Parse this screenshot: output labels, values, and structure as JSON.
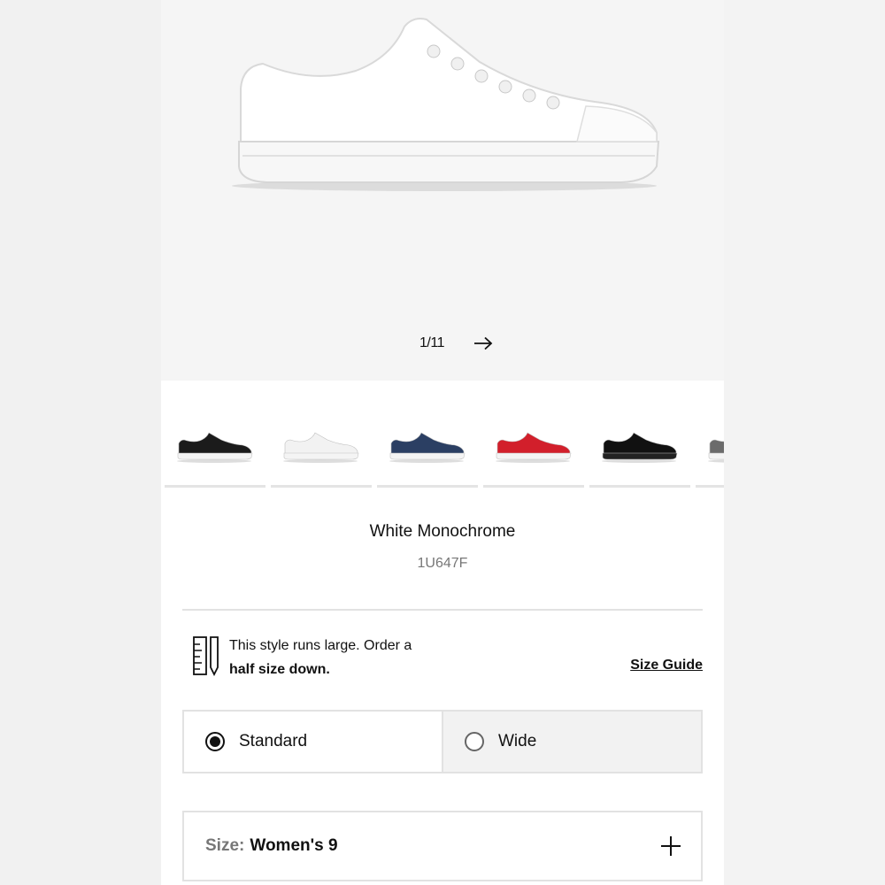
{
  "gallery": {
    "counter": "1/11",
    "next_icon": "arrow-right-icon"
  },
  "variants": [
    {
      "name": "black",
      "color": "#1b1b1b"
    },
    {
      "name": "white",
      "color": "#f2f2f2"
    },
    {
      "name": "navy",
      "color": "#2b3f63"
    },
    {
      "name": "red",
      "color": "#d21f2b"
    },
    {
      "name": "black-monochrome",
      "color": "#111111"
    },
    {
      "name": "grey",
      "color": "#6b6b6b"
    }
  ],
  "product": {
    "color_name": "White Monochrome",
    "style_code": "1U647F"
  },
  "fit": {
    "icon": "ruler-pencil-icon",
    "line1": "This style runs large. Order a",
    "line2": "half size down.",
    "size_guide_label": "Size Guide"
  },
  "width_options": {
    "standard_label": "Standard",
    "wide_label": "Wide",
    "selected": "Standard"
  },
  "size": {
    "label": "Size:",
    "value": "Women's 9",
    "expand_icon": "plus-icon"
  },
  "colors": {
    "accent": "#111111",
    "border": "#e2e2e2",
    "muted_text": "#777777"
  }
}
